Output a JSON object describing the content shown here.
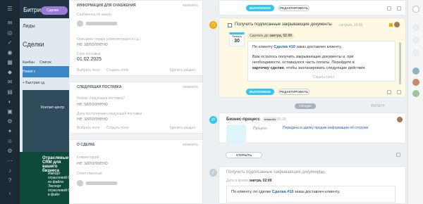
{
  "bg": {
    "app_title": "Битрикс",
    "pill": "Сделки",
    "tab_leads": "Лиды",
    "deals_title": "Сделки",
    "kanban": "Канбан",
    "list": "Список",
    "new_deal": "Новая с",
    "add_button": "+ Быстрая сд",
    "contact_center": "Контакт-центр",
    "promo_title": "Отраслевые CRM для вашего бизнеса",
    "promo_item": "Импорт отраслевой CRM из файла",
    "promo_item2": "Экспорт отраслевой CRM в файл"
  },
  "panel": {
    "card1": {
      "title": "Информация для снабжения",
      "edit": "изменить",
      "l1": "Снабженец по заказу",
      "l2": "Описание товара (комплектация и т.д.)",
      "v2": "не заполнено",
      "l3": "Срок поставки",
      "v3": "01.02.2025",
      "choose": "Выбрать поле",
      "create": "Создать поле",
      "delete": "Удалить раздел"
    },
    "card2": {
      "title": "Следующая поставка",
      "edit": "изменить",
      "l1": "Нужна следующая поставка?",
      "v1": "не заполнено",
      "l2": "Дата поступления следующей поставки",
      "v2": "не заполнено",
      "choose": "Выбрать поле",
      "create": "Создать поле",
      "delete": "Удалить раздел"
    },
    "card3": {
      "title": "О сделке",
      "edit": "изменить",
      "l1": "Комментарий",
      "v1": "не заполнено",
      "l2": "Ответственный"
    }
  },
  "timeline": {
    "top_done": "ВЫПОЛНЕНО",
    "top_edit": "РЕДАКТИРОВАТЬ",
    "task1": {
      "title": "Получить подписанные закрывающие документы",
      "time": "сегодня, 15:39",
      "deadline_label": "Сделать до",
      "deadline": "завтра, 02:00",
      "cal_month": "Январь",
      "cal_day": "30",
      "cal_weekday": "вторник",
      "line1_a": "По клиенту",
      "line1_b": "Сделка #10",
      "line1_c": "заказ доставлен клиенту.",
      "line2": "Вам осталось получить закрывающие документы и, при",
      "line3": "необходимости, оставшуюся часть оплаты. Перейдите в",
      "line4_a": "карточку сделки",
      "line4_b": ", чтобы запланировать следующие действия.",
      "hide": "Скрыть текст",
      "done": "ВЫПОЛНЕНО",
      "edit": "РЕДАКТИРОВАТЬ"
    },
    "today": "Сегодня",
    "filter": "ФИЛЬТР",
    "bp": {
      "title": "Бизнес-процесс",
      "tag": "отменён",
      "time": "15:39",
      "proc_label": "Процесс",
      "proc_value": "Передача в сделку продаж информации об отгрузке",
      "open": "ОТКРЫТЬ"
    },
    "task2": {
      "title": "Получить подписанные закрывающие документы",
      "time": "15:39",
      "date_label": "Дата и время",
      "date_value": "завтра, 02:00",
      "line_a": "По клиенту,",
      "line_b": "по сделке",
      "line_c": "Сделка #10",
      "line_d": "заказ доставлен клиенту."
    }
  },
  "colors": {
    "accent": "#2fc6f6",
    "link": "#2067b0",
    "note_bg": "#fef9e3"
  }
}
